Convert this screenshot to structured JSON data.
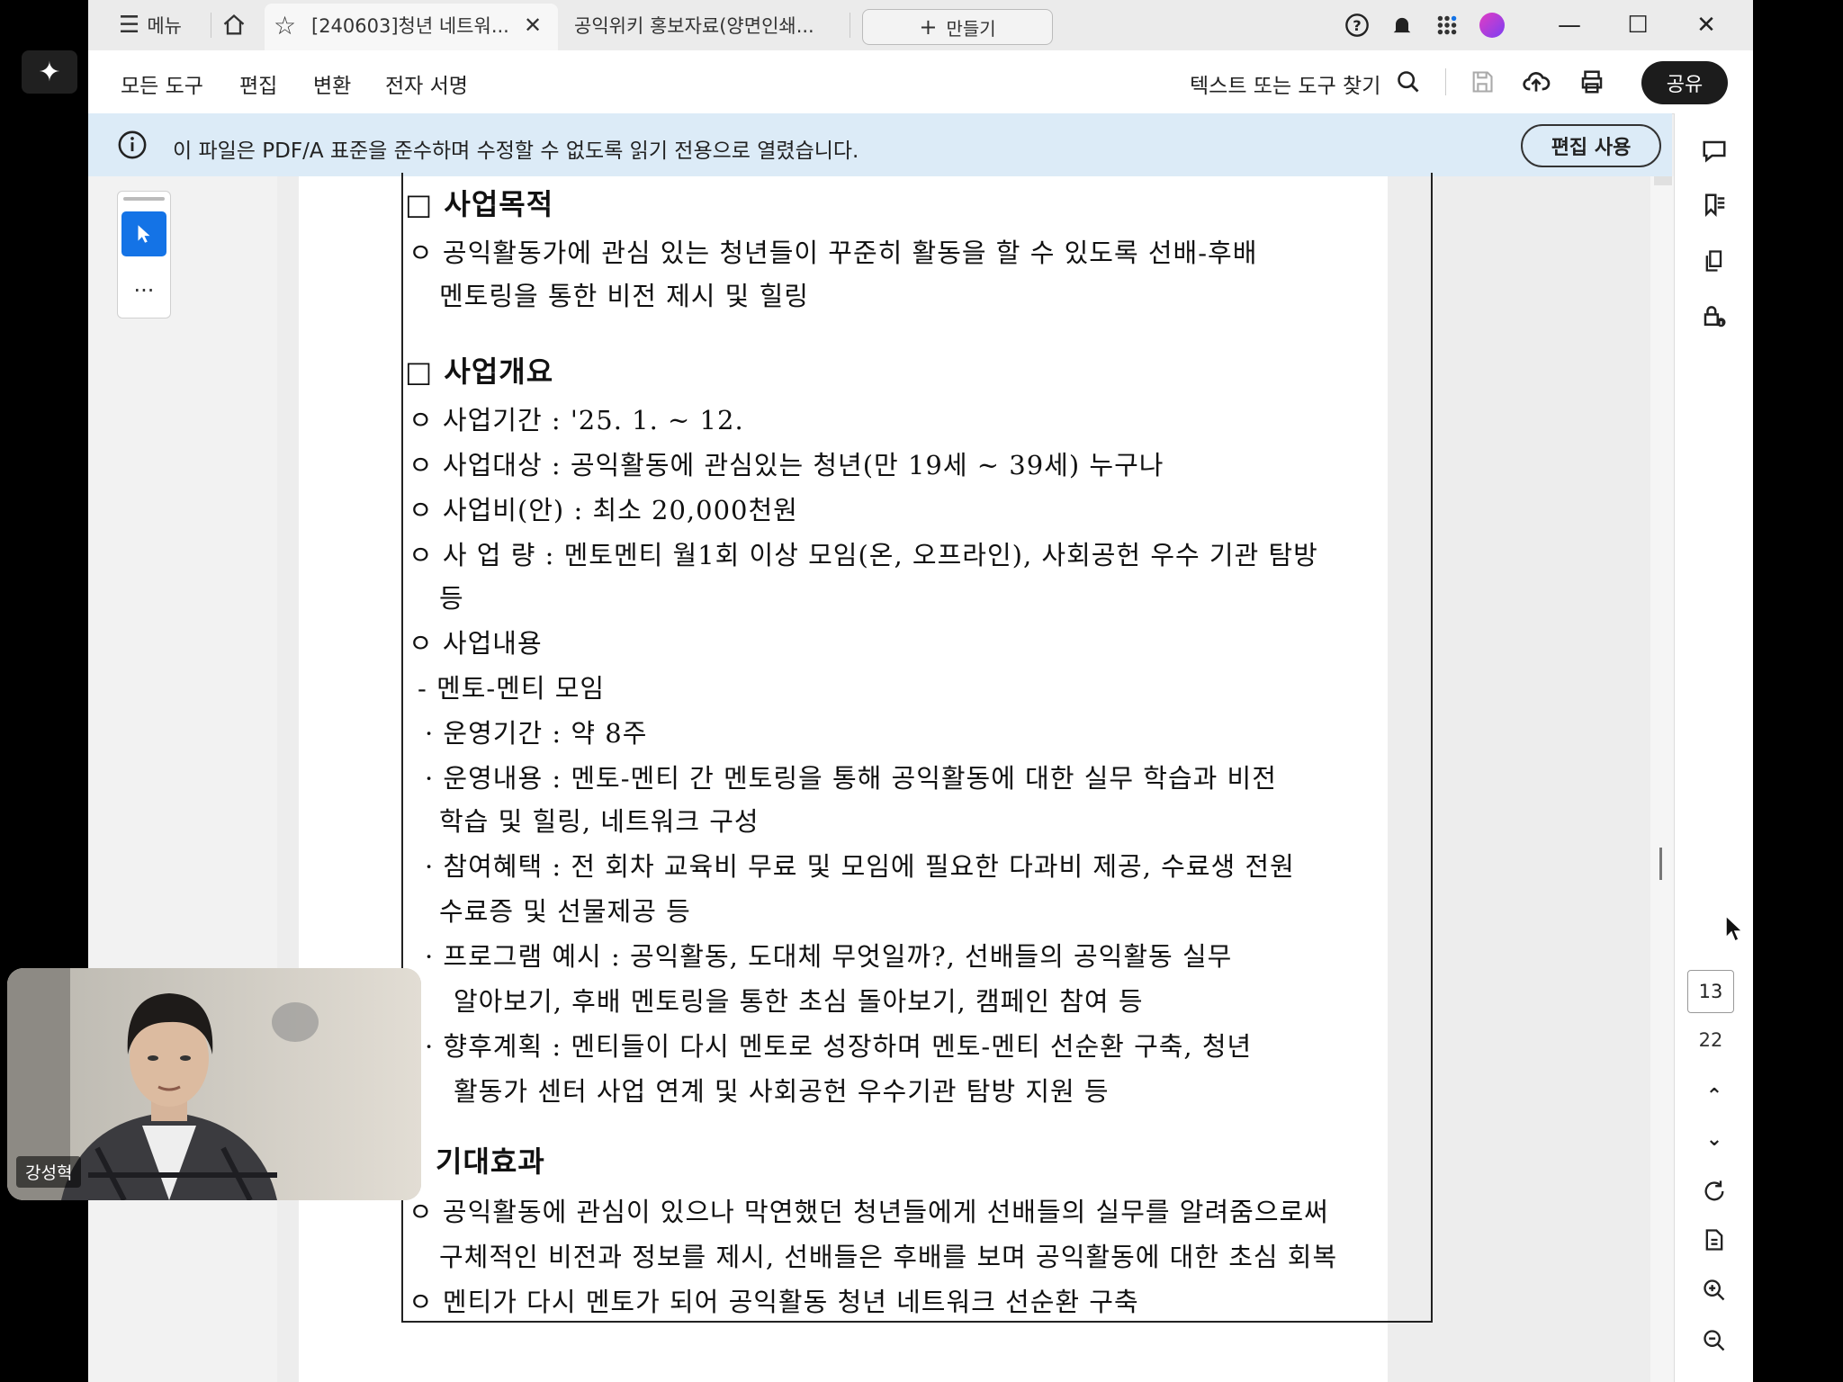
{
  "titlebar": {
    "menu_label": "메뉴",
    "tabs": [
      {
        "label": "[240603]청년 네트워..."
      },
      {
        "label": "공익위키 홍보자료(양면인쇄..."
      }
    ],
    "create_label": "만들기"
  },
  "toolbar": {
    "menu_items": [
      "모든 도구",
      "편집",
      "변환",
      "전자 서명"
    ],
    "search_label": "텍스트 또는 도구 찾기",
    "share_label": "공유"
  },
  "banner": {
    "message": "이 파일은 PDF/A 표준을 준수하며 수정할 수 없도록 읽기 전용으로 열렸습니다.",
    "edit_button": "편집 사용"
  },
  "pager": {
    "current": "13",
    "total": "22"
  },
  "webcam": {
    "name": "강성혁"
  },
  "document": {
    "lines": [
      "□ 사업목적",
      "ㅇ 공익활동가에 관심 있는 청년들이 꾸준히 활동을 할 수 있도록 선배-후배",
      "멘토링을 통한 비전 제시 및 힐링",
      "□ 사업개요",
      "ㅇ 사업기간 : '25. 1. ~ 12.",
      "ㅇ 사업대상 : 공익활동에 관심있는 청년(만 19세 ~ 39세) 누구나",
      "ㅇ 사업비(안) : 최소 20,000천원",
      "ㅇ 사 업 량 : 멘토멘티 월1회 이상 모임(온, 오프라인), 사회공헌 우수 기관 탐방",
      "등",
      "ㅇ 사업내용",
      "- 멘토-멘티 모임",
      "· 운영기간 : 약 8주",
      "· 운영내용 : 멘토-멘티 간 멘토링을 통해 공익활동에 대한 실무 학습과 비전",
      "학습 및 힐링, 네트워크 구성",
      "· 참여혜택 : 전 회차 교육비 무료 및 모임에 필요한 다과비 제공, 수료생 전원",
      "수료증 및 선물제공 등",
      "· 프로그램 예시 : 공익활동, 도대체 무엇일까?, 선배들의 공익활동 실무",
      "알아보기, 후배 멘토링을 통한 초심 돌아보기, 캠페인 참여 등",
      "· 향후계획 : 멘티들이 다시 멘토로 성장하며 멘토-멘티 선순환 구축, 청년",
      "활동가 센터 사업 연계 및 사회공헌 우수기관 탐방 지원 등",
      "기대효과",
      "ㅇ 공익활동에 관심이 있으나 막연했던 청년들에게 선배들의 실무를 알려줌으로써",
      "구체적인 비전과 정보를 제시, 선배들은 후배를 보며 공익활동에 대한 초심 회복",
      "ㅇ 멘티가 다시 멘토가 되어 공익활동 청년 네트워크 선순환 구축"
    ]
  }
}
